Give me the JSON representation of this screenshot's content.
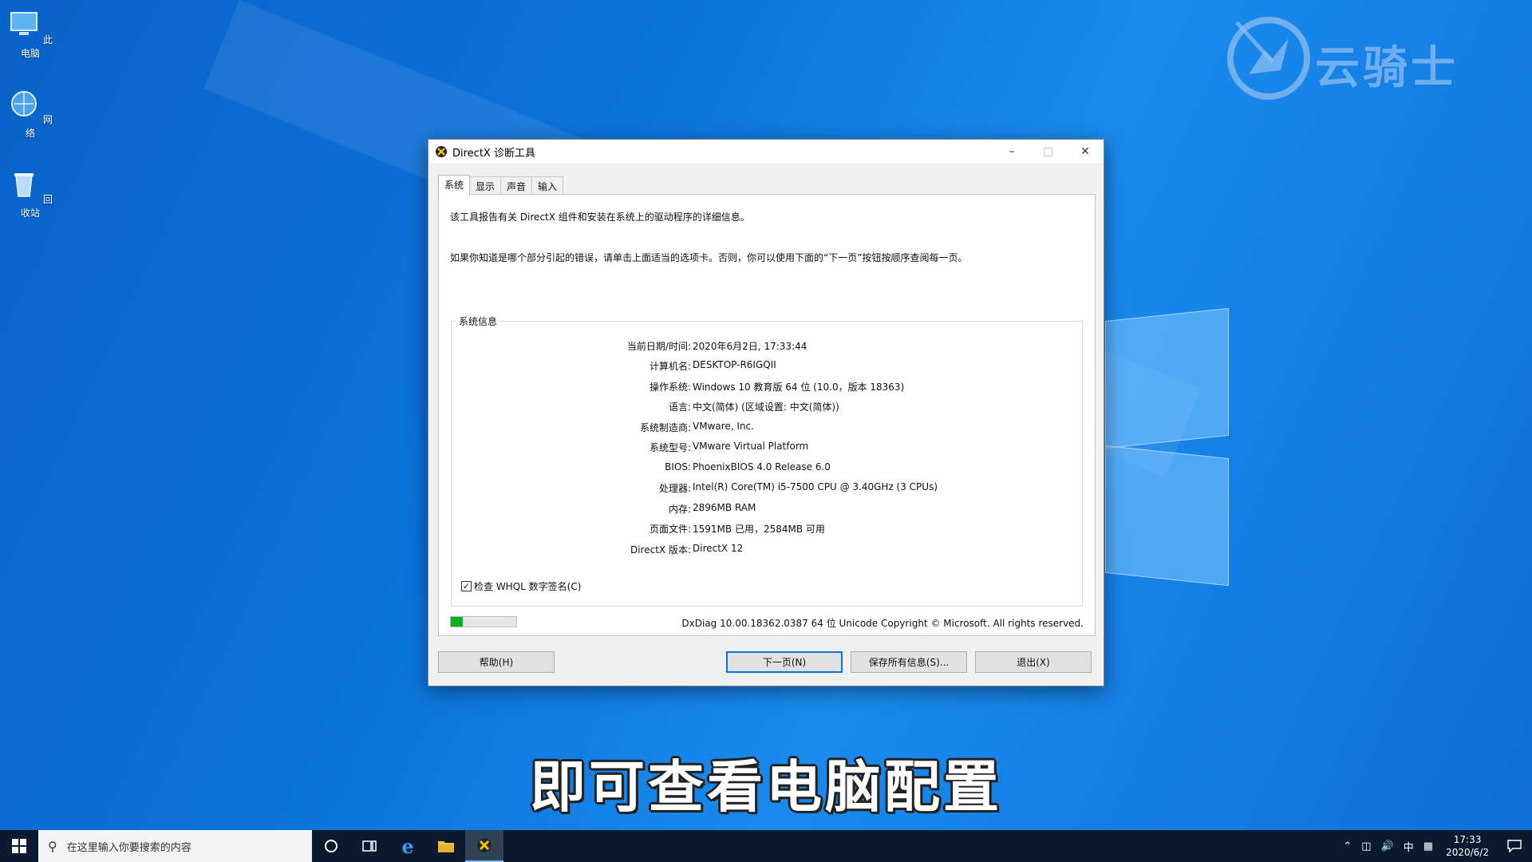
{
  "desktop": {
    "icons": [
      {
        "label": "此电脑",
        "icon": "computer-icon"
      },
      {
        "label": "网络",
        "icon": "network-icon"
      },
      {
        "label": "回收站",
        "icon": "recycle-bin-icon"
      }
    ],
    "watermark_text": "云骑士"
  },
  "dialog": {
    "title": "DirectX 诊断工具",
    "tabs": [
      {
        "label": "系统",
        "active": true
      },
      {
        "label": "显示",
        "active": false
      },
      {
        "label": "声音",
        "active": false
      },
      {
        "label": "输入",
        "active": false
      }
    ],
    "intro_line1": "该工具报告有关 DirectX 组件和安装在系统上的驱动程序的详细信息。",
    "intro_line2": "如果你知道是哪个部分引起的错误，请单击上面适当的选项卡。否则，你可以使用下面的“下一页”按钮按顺序查阅每一页。",
    "system_info": {
      "legend": "系统信息",
      "rows": [
        {
          "label": "当前日期/时间:",
          "value": "2020年6月2日, 17:33:44"
        },
        {
          "label": "计算机名:",
          "value": "DESKTOP-R6IGQII"
        },
        {
          "label": "操作系统:",
          "value": "Windows 10 教育版 64 位 (10.0，版本 18363)"
        },
        {
          "label": "语言:",
          "value": "中文(简体) (区域设置: 中文(简体))"
        },
        {
          "label": "系统制造商:",
          "value": "VMware, Inc."
        },
        {
          "label": "系统型号:",
          "value": "VMware Virtual Platform"
        },
        {
          "label": "BIOS:",
          "value": "PhoenixBIOS 4.0 Release 6.0"
        },
        {
          "label": "处理器:",
          "value": "Intel(R) Core(TM) i5-7500 CPU @ 3.40GHz (3 CPUs)"
        },
        {
          "label": "内存:",
          "value": "2896MB RAM"
        },
        {
          "label": "页面文件:",
          "value": "1591MB 已用，2584MB 可用"
        },
        {
          "label": "DirectX 版本:",
          "value": "DirectX 12"
        }
      ]
    },
    "whql_checkbox": {
      "label": "检查 WHQL 数字签名(C)",
      "checked": true
    },
    "progress_fraction": 0.18,
    "copyright": "DxDiag 10.00.18362.0387 64 位 Unicode  Copyright © Microsoft. All rights reserved.",
    "buttons": {
      "help": "帮助(H)",
      "next": "下一页(N)",
      "save": "保存所有信息(S)...",
      "exit": "退出(X)"
    }
  },
  "subtitle": "即可查看电脑配置",
  "taskbar": {
    "search_placeholder": "在这里输入你要搜索的内容",
    "ime": "中",
    "time": "17:33",
    "date": "2020/6/2"
  },
  "colors": {
    "progress_green": "#06b025",
    "accent_blue": "#0078d7",
    "taskbar_bg": "#0b1a2e"
  }
}
